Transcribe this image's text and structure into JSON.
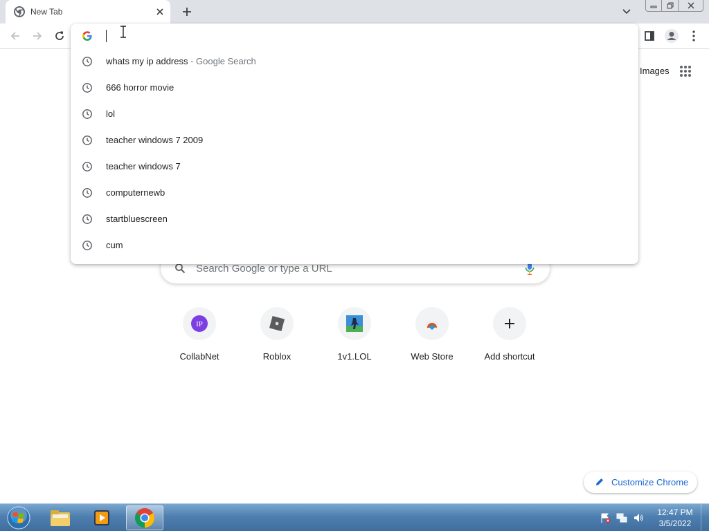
{
  "browser": {
    "tab": {
      "title": "New Tab",
      "favicon": "chrome-icon",
      "close_icon": "close-icon"
    },
    "new_tab_icon": "plus-icon",
    "tab_search_icon": "chevron-down-icon",
    "window_controls": [
      "minimize-icon",
      "restore-icon",
      "close-icon"
    ],
    "toolbar": {
      "back_icon": "arrow-left-icon",
      "forward_icon": "arrow-right-icon",
      "reload_icon": "reload-icon",
      "side_panel_icon": "side-panel-icon",
      "profile_icon": "profile-icon",
      "menu_icon": "kebab-menu-icon"
    }
  },
  "omnibox": {
    "value": "",
    "engine_icon": "google-g-icon",
    "suggestions": [
      {
        "text": "whats my ip address",
        "hint": " - Google Search",
        "icon": "clock-icon"
      },
      {
        "text": "666 horror movie",
        "hint": "",
        "icon": "clock-icon"
      },
      {
        "text": "lol",
        "hint": "",
        "icon": "clock-icon"
      },
      {
        "text": "teacher windows 7 2009",
        "hint": "",
        "icon": "clock-icon"
      },
      {
        "text": "teacher windows 7",
        "hint": "",
        "icon": "clock-icon"
      },
      {
        "text": "computernewb",
        "hint": "",
        "icon": "clock-icon"
      },
      {
        "text": "startbluescreen",
        "hint": "",
        "icon": "clock-icon"
      },
      {
        "text": "cum",
        "hint": "",
        "icon": "clock-icon"
      }
    ]
  },
  "ntp": {
    "images_link": "Images",
    "apps_icon": "apps-grid-icon",
    "search_placeholder": "Search Google or type a URL",
    "shortcuts": [
      {
        "label": "CollabNet",
        "icon": "collabnet-icon"
      },
      {
        "label": "Roblox",
        "icon": "roblox-icon"
      },
      {
        "label": "1v1.LOL",
        "icon": "1v1lol-icon"
      },
      {
        "label": "Web Store",
        "icon": "web-store-icon"
      },
      {
        "label": "Add shortcut",
        "icon": "plus-icon"
      }
    ],
    "customize_label": "Customize Chrome"
  },
  "taskbar": {
    "start_icon": "windows-start-icon",
    "pinned": [
      "explorer-icon",
      "media-player-icon",
      "chrome-icon"
    ],
    "active_app": "chrome-icon",
    "time": "12:47 PM",
    "date": "3/5/2022"
  }
}
